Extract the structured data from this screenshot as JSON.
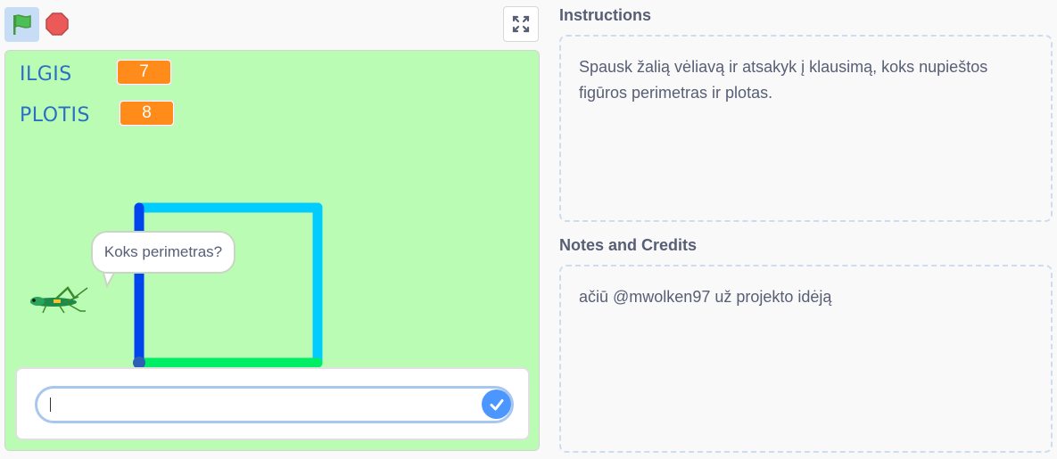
{
  "controls": {
    "green_flag_icon": "green-flag-icon",
    "stop_icon": "stop-sign-icon",
    "fullscreen_icon": "fullscreen-icon"
  },
  "stage": {
    "variables": [
      {
        "label": "ILGIS",
        "value": "7"
      },
      {
        "label": "PLOTIS",
        "value": "8"
      }
    ],
    "speech_bubble": "Koks perimetras?",
    "answer_input": {
      "value": ""
    }
  },
  "instructions": {
    "heading": "Instructions",
    "text": "Spausk žalią vėliavą ir atsakyk į klausimą, koks nupieštos figūros perimetras ir plotas."
  },
  "notes": {
    "heading": "Notes and Credits",
    "text": "ačiū @mwolken97 už projekto idėją"
  },
  "colors": {
    "stage_bg": "#bbfcb5",
    "variable_bg": "#ff8c1a",
    "accent_blue": "#4c97ff",
    "line_light_blue": "#00ccff",
    "line_dark_blue": "#0044ee",
    "line_green": "#00ee66"
  }
}
